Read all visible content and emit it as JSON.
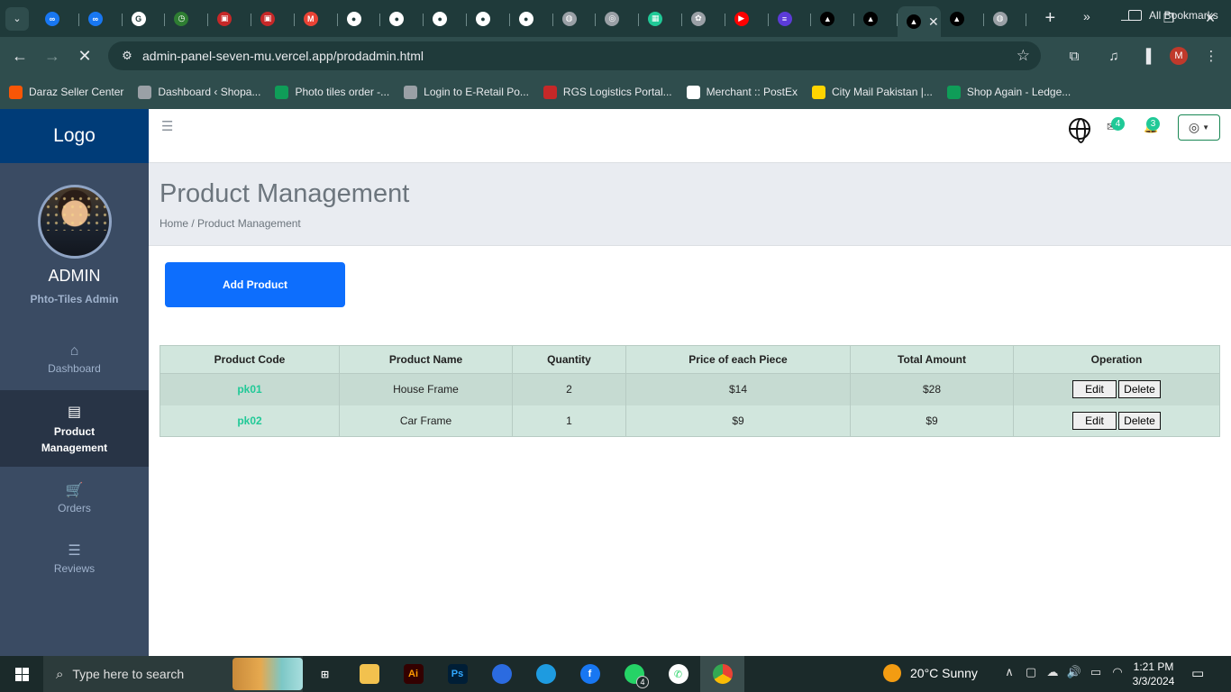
{
  "browser": {
    "tabs": [
      {
        "icon": "meta-icon",
        "color": "#1877f2",
        "glyph": "∞"
      },
      {
        "icon": "meta-icon",
        "color": "#1877f2",
        "glyph": "∞"
      },
      {
        "icon": "google-icon",
        "color": "#ffffff",
        "glyph": "G"
      },
      {
        "icon": "clock-icon",
        "color": "#2e7d32",
        "glyph": "◷"
      },
      {
        "icon": "rgs-icon",
        "color": "#c62828",
        "glyph": "▣"
      },
      {
        "icon": "rgs-icon",
        "color": "#c62828",
        "glyph": "▣"
      },
      {
        "icon": "gmail-icon",
        "color": "#ea4335",
        "glyph": "M"
      },
      {
        "icon": "github-icon",
        "color": "#ffffff",
        "glyph": "●"
      },
      {
        "icon": "github-icon",
        "color": "#ffffff",
        "glyph": "●"
      },
      {
        "icon": "github-icon",
        "color": "#ffffff",
        "glyph": "●"
      },
      {
        "icon": "github-icon",
        "color": "#ffffff",
        "glyph": "●"
      },
      {
        "icon": "github-icon",
        "color": "#ffffff",
        "glyph": "●"
      },
      {
        "icon": "globe-icon",
        "color": "#9aa0a6",
        "glyph": "◍"
      },
      {
        "icon": "chrome-icon",
        "color": "#9aa0a6",
        "glyph": "◎"
      },
      {
        "icon": "sheet-icon",
        "color": "#20c997",
        "glyph": "▦"
      },
      {
        "icon": "openai-icon",
        "color": "#9aa0a6",
        "glyph": "✿"
      },
      {
        "icon": "youtube-icon",
        "color": "#ff0000",
        "glyph": "▶"
      },
      {
        "icon": "list-icon",
        "color": "#5c3bd8",
        "glyph": "≡"
      },
      {
        "icon": "vercel-icon",
        "color": "#000000",
        "glyph": "▲"
      },
      {
        "icon": "vercel-icon",
        "color": "#000000",
        "glyph": "▲"
      },
      {
        "icon": "vercel-icon",
        "color": "#000000",
        "glyph": "▲",
        "active": true
      },
      {
        "icon": "vercel-icon",
        "color": "#000000",
        "glyph": "▲"
      },
      {
        "icon": "globe-icon",
        "color": "#9aa0a6",
        "glyph": "◍"
      }
    ],
    "url": "admin-panel-seven-mu.vercel.app/prodadmin.html",
    "profile_initial": "M",
    "bookmarks": [
      {
        "label": "Daraz Seller Center",
        "icon": "daraz-icon",
        "color": "#f85606"
      },
      {
        "label": "Dashboard ‹ Shopa...",
        "icon": "globe-icon",
        "color": "#9aa0a6"
      },
      {
        "label": "Photo tiles order -...",
        "icon": "sheet-icon",
        "color": "#0f9d58"
      },
      {
        "label": "Login to E-Retail Po...",
        "icon": "globe-icon",
        "color": "#9aa0a6"
      },
      {
        "label": "RGS Logistics Portal...",
        "icon": "rgs-icon",
        "color": "#c62828"
      },
      {
        "label": "Merchant :: PostEx",
        "icon": "postex-icon",
        "color": "#ffffff"
      },
      {
        "label": "City Mail Pakistan |...",
        "icon": "citymail-icon",
        "color": "#ffd400"
      },
      {
        "label": "Shop Again - Ledge...",
        "icon": "sheet-icon",
        "color": "#0f9d58"
      }
    ],
    "all_bookmarks": "All Bookmarks"
  },
  "sidebar": {
    "logo": "Logo",
    "admin_name": "ADMIN",
    "admin_role": "Phto-Tiles Admin",
    "items": [
      {
        "label": "Dashboard",
        "icon": "home-icon",
        "glyph": "⌂"
      },
      {
        "label": "Product Management",
        "icon": "clipboard-icon",
        "glyph": "▤",
        "active": true
      },
      {
        "label": "Orders",
        "icon": "cart-icon",
        "glyph": "🛒"
      },
      {
        "label": "Reviews",
        "icon": "list-check-icon",
        "glyph": "☰"
      }
    ]
  },
  "topbar": {
    "messages_count": "4",
    "notifications_count": "3"
  },
  "page": {
    "title": "Product Management",
    "breadcrumb": "Home / Product Management",
    "add_button": "Add Product"
  },
  "table": {
    "headers": [
      "Product Code",
      "Product Name",
      "Quantity",
      "Price of each Piece",
      "Total Amount",
      "Operation"
    ],
    "rows": [
      {
        "code": "pk01",
        "name": "House Frame",
        "quantity": "2",
        "price": "$14",
        "total": "$28"
      },
      {
        "code": "pk02",
        "name": "Car Frame",
        "quantity": "1",
        "price": "$9",
        "total": "$9"
      }
    ],
    "edit_label": "Edit",
    "delete_label": "Delete"
  },
  "taskbar": {
    "search_placeholder": "Type here to search",
    "weather": "20°C  Sunny",
    "time": "1:21 PM",
    "date": "3/3/2024",
    "whatsapp_badge": "4"
  }
}
